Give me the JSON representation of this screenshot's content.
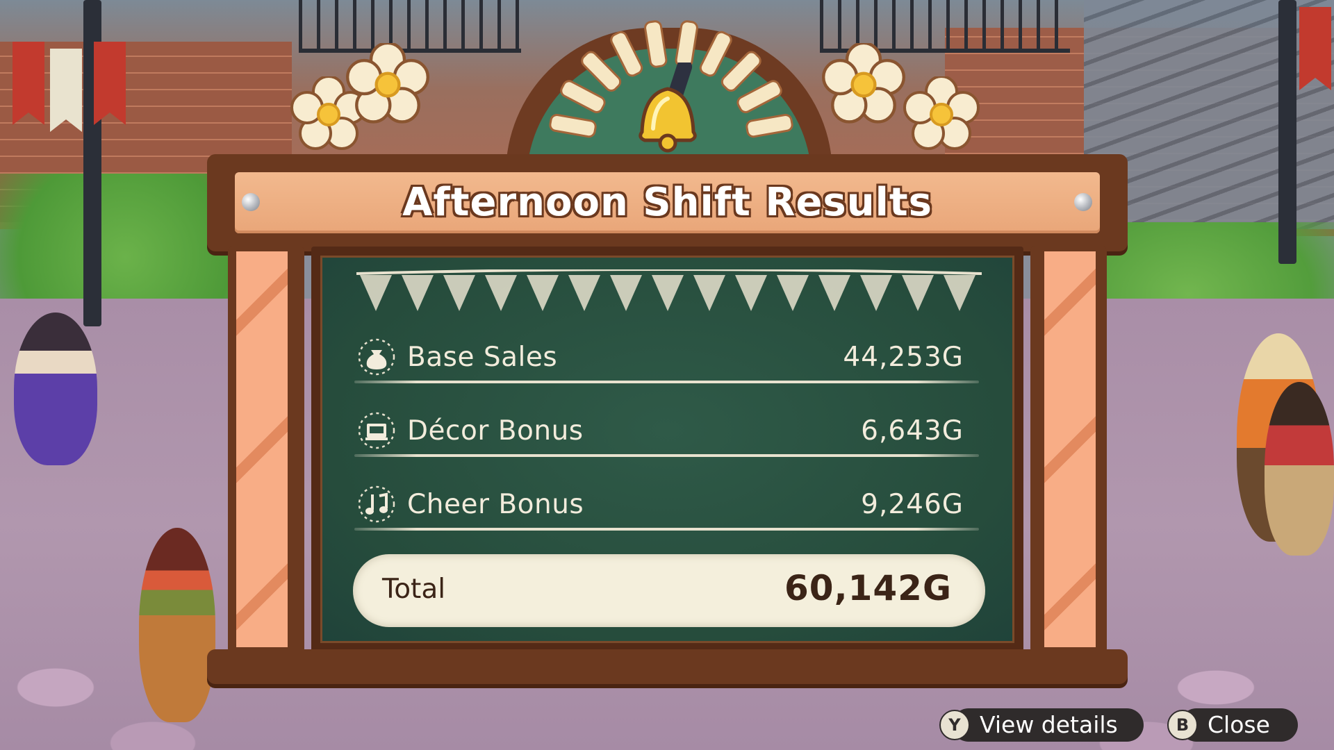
{
  "title": "Afternoon Shift Results",
  "rows": [
    {
      "label": "Base Sales",
      "value": "44,253G",
      "icon": "money-bag-icon"
    },
    {
      "label": "Décor Bonus",
      "value": "6,643G",
      "icon": "decor-icon"
    },
    {
      "label": "Cheer Bonus",
      "value": "9,246G",
      "icon": "music-note-icon"
    }
  ],
  "total": {
    "label": "Total",
    "value": "60,142G"
  },
  "prompts": {
    "details": {
      "button": "Y",
      "label": "View details"
    },
    "close": {
      "button": "B",
      "label": "Close"
    }
  },
  "colors": {
    "board_wood": "#6b391f",
    "title_plate": "#efb38a",
    "chalkboard": "#2a5242",
    "chalk_text": "#f2ecdc",
    "total_pill": "#f4efdc"
  }
}
